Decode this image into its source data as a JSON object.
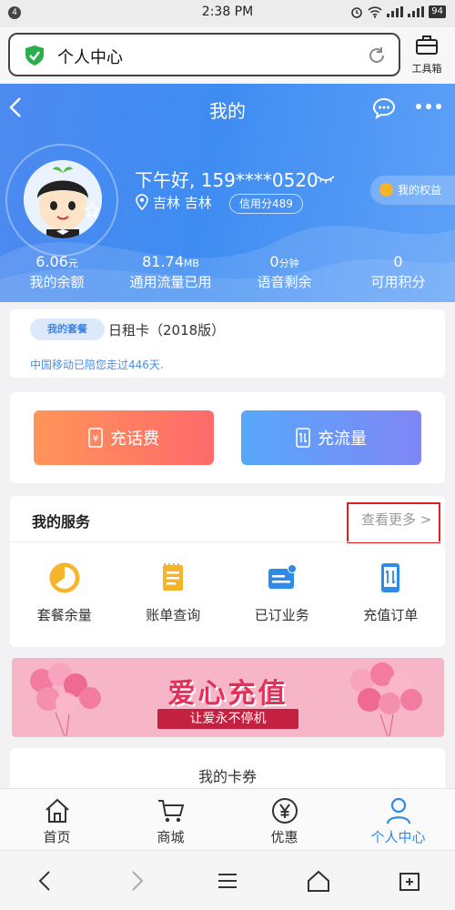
{
  "status_bar": {
    "notification_count": "4",
    "time": "2:38 PM",
    "battery": "94"
  },
  "browser": {
    "url_title": "个人中心",
    "toolbox_label": "工具箱"
  },
  "header": {
    "title": "我的"
  },
  "profile": {
    "greeting": "下午好, 159****0520",
    "location": "吉林 吉林",
    "credit": "信用分489",
    "rights_label": "我的权益"
  },
  "stats": [
    {
      "value": "6.06",
      "unit": "元",
      "label": "我的余额"
    },
    {
      "value": "81.74",
      "unit": "MB",
      "label": "通用流量已用"
    },
    {
      "value": "0",
      "unit": "分钟",
      "label": "语音剩余"
    },
    {
      "value": "0",
      "unit": "",
      "label": "可用积分"
    }
  ],
  "package": {
    "tag": "我的套餐",
    "name": "日租卡（2018版）",
    "note": "中国移动已陪您走过446天."
  },
  "recharge": {
    "call_label": "充话费",
    "data_label": "充流量"
  },
  "services": {
    "title": "我的服务",
    "more_label": "查看更多",
    "items": [
      {
        "label": "套餐余量",
        "icon": "pie-chart-icon"
      },
      {
        "label": "账单查询",
        "icon": "bill-icon"
      },
      {
        "label": "已订业务",
        "icon": "subscribed-icon"
      },
      {
        "label": "充值订单",
        "icon": "recharge-order-icon"
      }
    ]
  },
  "banner": {
    "title": "爱心充值",
    "subtitle": "让爱永不停机"
  },
  "coupons": {
    "label": "我的卡券"
  },
  "tabs": [
    {
      "label": "首页",
      "icon": "home-icon"
    },
    {
      "label": "商城",
      "icon": "cart-icon"
    },
    {
      "label": "优惠",
      "icon": "yen-coin-icon"
    },
    {
      "label": "个人中心",
      "icon": "person-icon"
    }
  ],
  "colors": {
    "accent": "#2e8be8",
    "hero_blue": "#4d8af0",
    "highlight_red": "#e02020"
  }
}
